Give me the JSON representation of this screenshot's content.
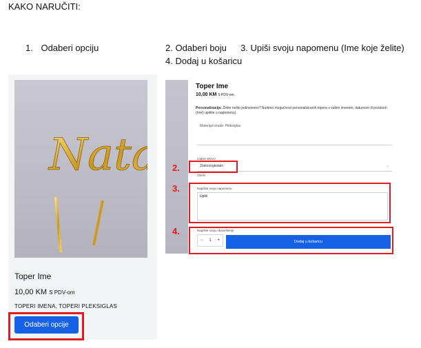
{
  "header": "KAKO NARUČITI:",
  "steps": {
    "s1_num": "1.",
    "s1_text": "Odaberi opciju",
    "s2": "2. Odaberi boju",
    "s3": "3. Upiši svoju napomenu (Ime koje želite)",
    "s4": "4. Dodaj u košaricu"
  },
  "product_card": {
    "title": "Toper Ime",
    "price": "10,00 KM",
    "price_suffix": "S PDV-om",
    "categories": "TOPERI IMENA, TOPERI PLEKSIGLAS",
    "button": "Odaberi opcije",
    "image_text": "Natali"
  },
  "product_page": {
    "title": "Toper Ime",
    "price": "10,00 KM",
    "price_suffix": "S PDV-om",
    "note_label": "Personalizacija:",
    "note_text": "Želite nešto jedinstveno? Nudimo mogućnost personaliziranih topera s vašim imenom, datumom ili porukom (Ime) upišite u napomenu).",
    "material": "Materijal izrade: Pleksiglas",
    "color_label": "Izaberi BOJU",
    "color_value": "Zlatno/ogledalo",
    "clear_label": "Obriši",
    "note_field_label": "Napišite svoju napomenu",
    "note_field_value": "Upiši",
    "qty_label": "Napišite svoju obaveštenje",
    "qty_minus": "−",
    "qty_value": "1",
    "qty_plus": "+",
    "add_to_cart": "Dodaj u košaricu",
    "marker_2": "2.",
    "marker_3": "3.",
    "marker_4": "4."
  },
  "colors": {
    "accent": "#1761e6",
    "highlight": "#e11b22",
    "gold": "#d4a72c"
  }
}
